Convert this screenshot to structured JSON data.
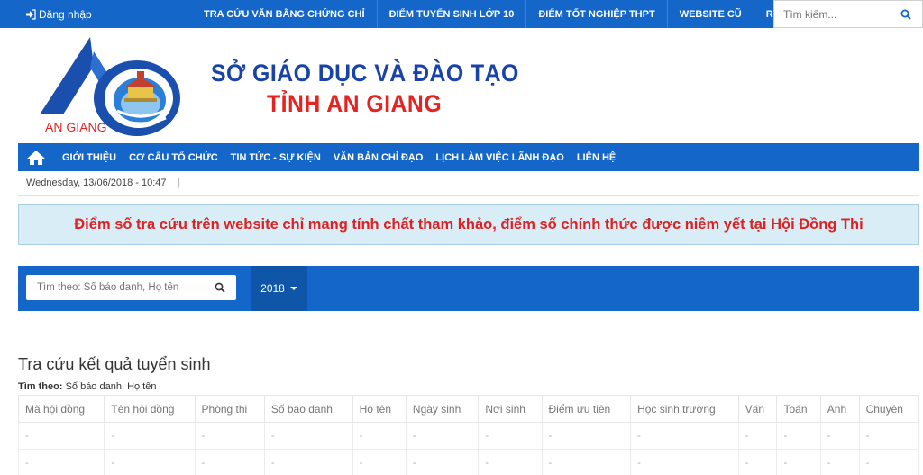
{
  "topbar": {
    "login_label": "Đăng nhập",
    "links": [
      "TRA CỨU VĂN BẰNG CHỨNG CHỈ",
      "ĐIỂM TUYỂN SINH LỚP 10",
      "ĐIỂM TỐT NGHIỆP THPT",
      "WEBSITE CŨ",
      "RSS"
    ],
    "search_placeholder": "Tìm kiếm..."
  },
  "header": {
    "logo_text": "AN GIANG",
    "title_line1": "SỞ GIÁO DỤC VÀ ĐÀO TẠO",
    "title_line2": "TỈNH AN GIANG"
  },
  "nav": {
    "items": [
      "GIỚI THIỆU",
      "CƠ CẤU TỔ CHỨC",
      "TIN TỨC - SỰ KIỆN",
      "VĂN BẢN CHỈ ĐẠO",
      "LỊCH LÀM VIỆC LÃNH ĐẠO",
      "LIÊN HỆ"
    ]
  },
  "dateline": {
    "date": "Wednesday, 13/06/2018 - 10:47",
    "separator": "|"
  },
  "notice": {
    "text": "Điểm số tra cứu trên website chỉ mang tính chất tham khảo, điểm số chính thức được niêm yết tại Hội Đồng Thi"
  },
  "search": {
    "placeholder": "Tìm theo: Số báo danh, Họ tên",
    "year": "2018"
  },
  "results": {
    "title": "Tra cứu kết quả tuyển sinh",
    "filter_label": "Tìm theo:",
    "filter_value": "Số báo danh, Họ tên",
    "columns": [
      "Mã hội đồng",
      "Tên hội đồng",
      "Phòng thi",
      "Số báo danh",
      "Họ tên",
      "Ngày sinh",
      "Nơi sinh",
      "Điểm ưu tiên",
      "Học sinh trường",
      "Văn",
      "Toán",
      "Anh",
      "Chuyên"
    ],
    "rows": [
      [
        "-",
        "-",
        "-",
        "-",
        "-",
        "-",
        "-",
        "-",
        "-",
        "-",
        "-",
        "-",
        "-"
      ],
      [
        "-",
        "-",
        "-",
        "-",
        "-",
        "-",
        "-",
        "-",
        "-",
        "-",
        "-",
        "-",
        "-"
      ]
    ]
  },
  "colors": {
    "primary_blue": "#1466c8",
    "notice_bg": "#d9edf7",
    "notice_text": "#e02020",
    "title_blue": "#1a43a8",
    "title_red": "#e52421"
  }
}
